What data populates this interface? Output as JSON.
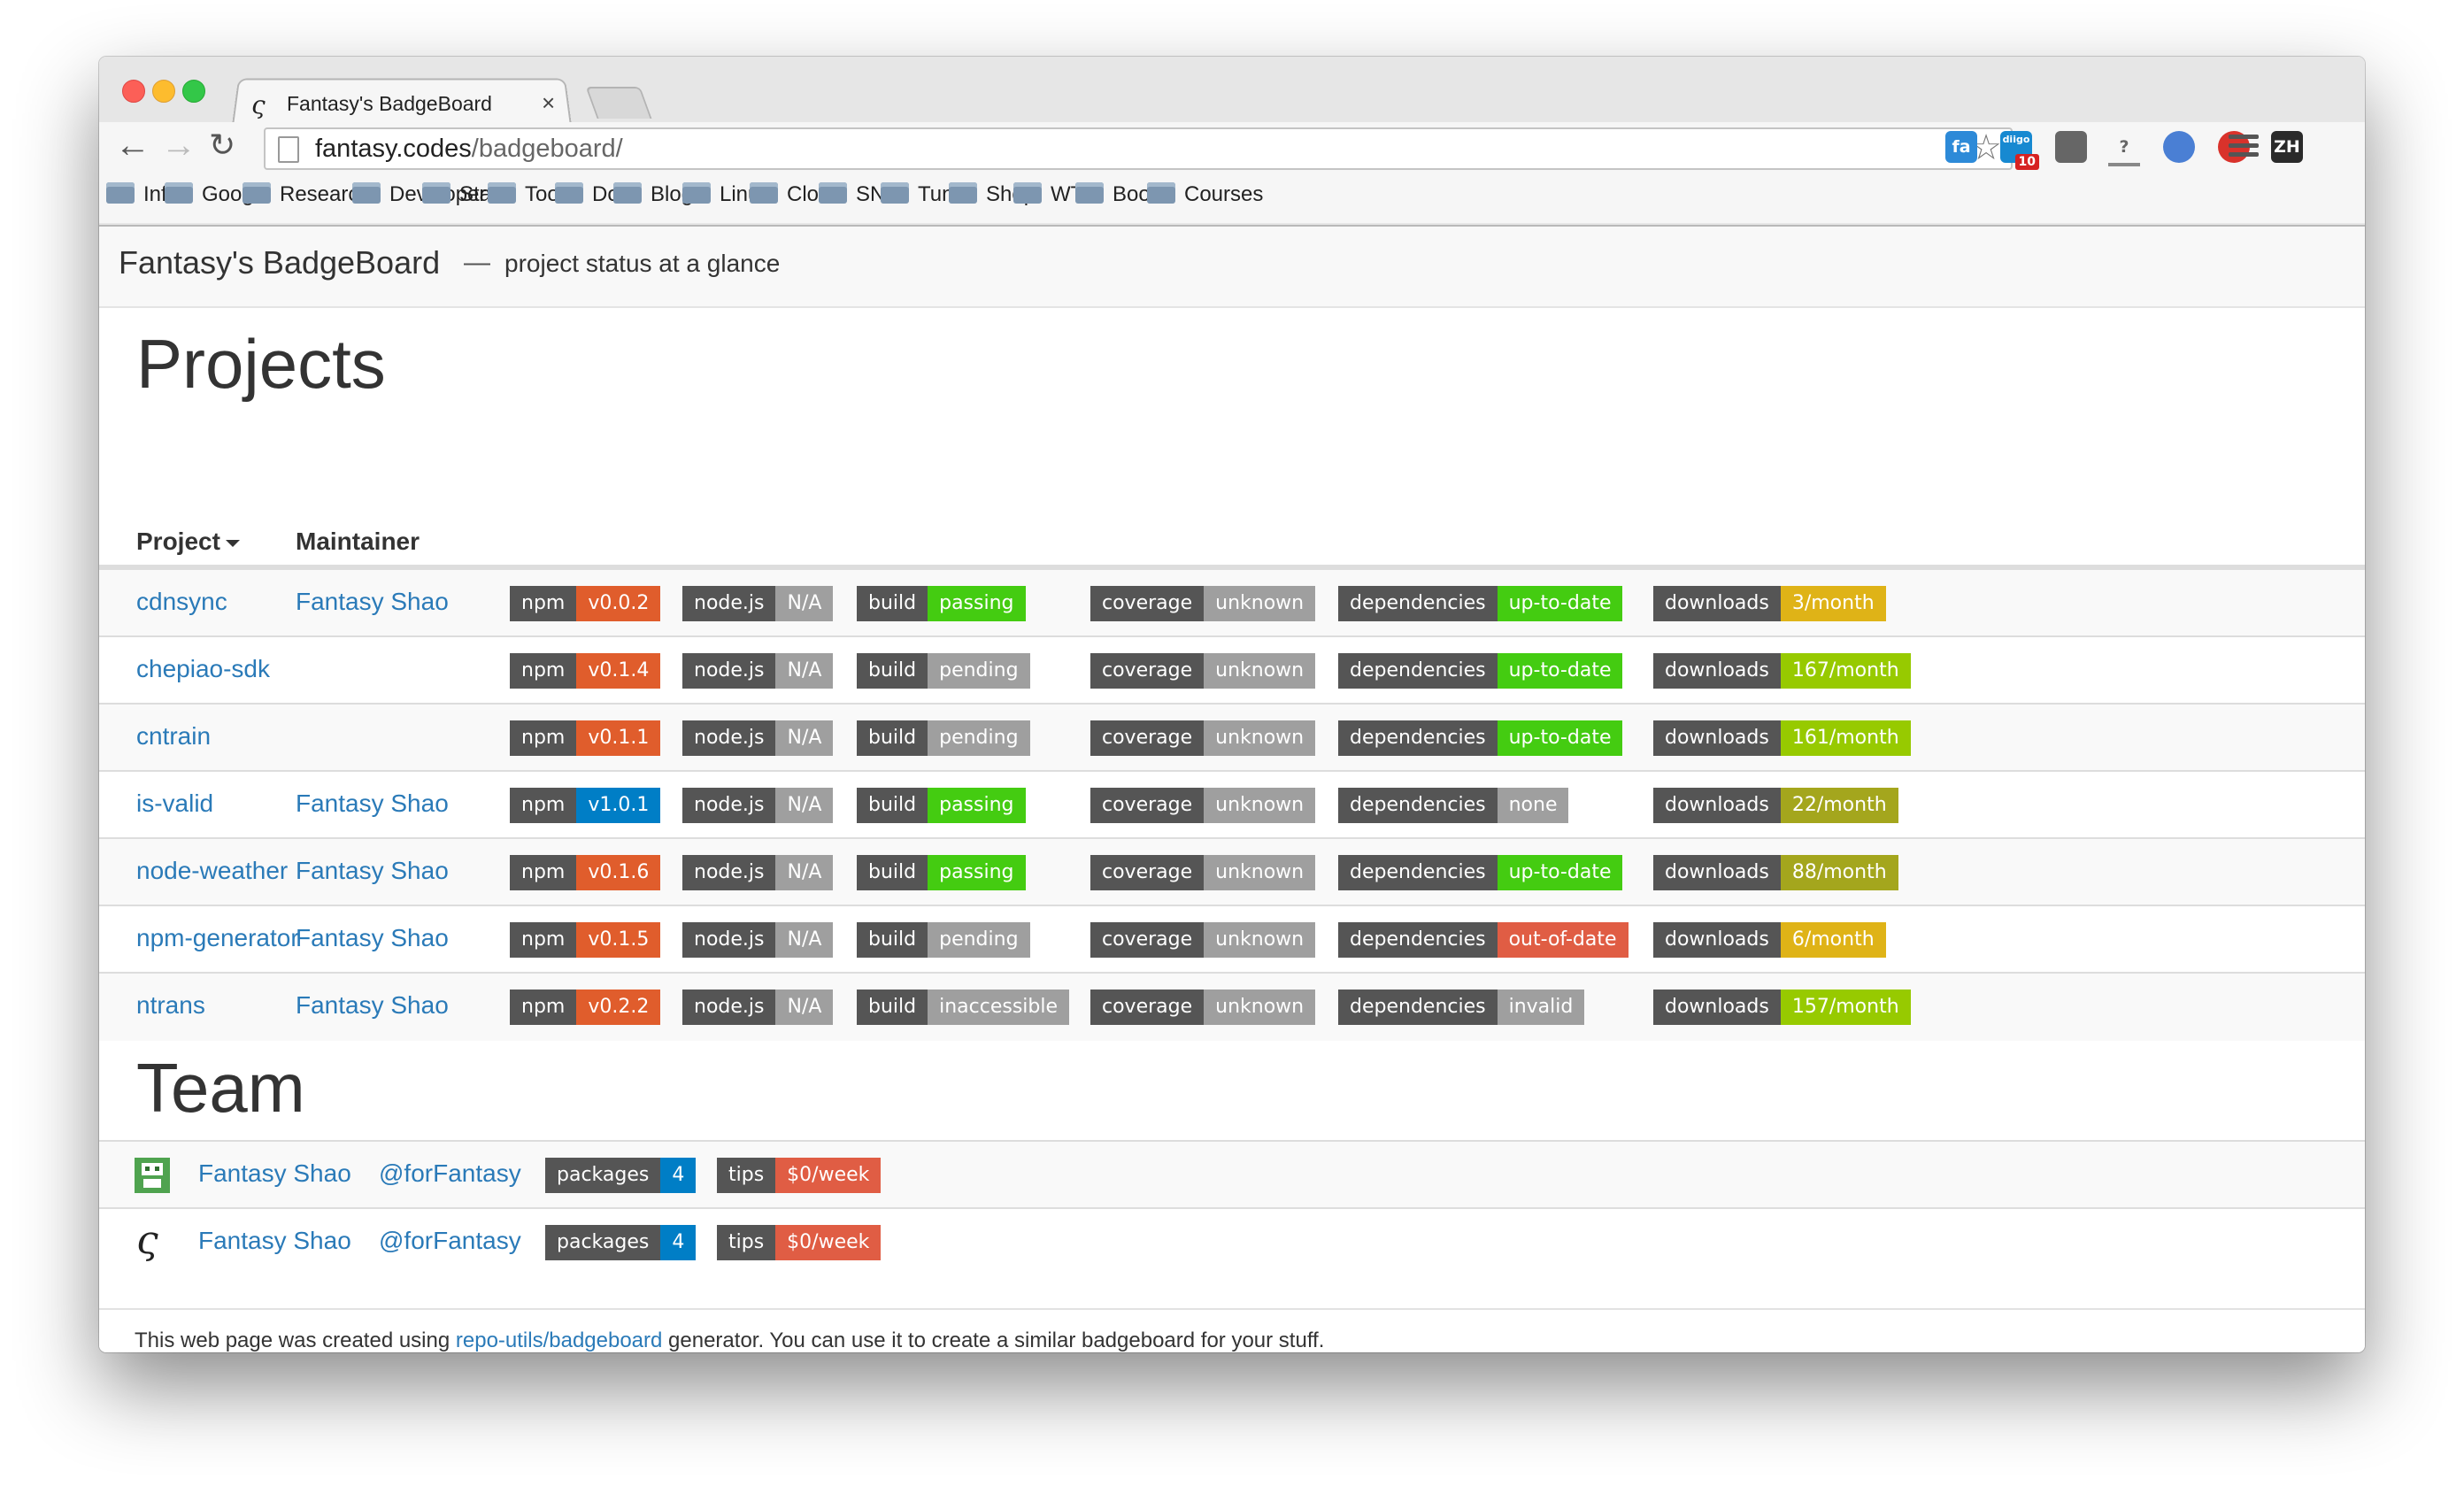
{
  "browser": {
    "tab_title": "Fantasy's BadgeBoard",
    "tab_favicon": "ς",
    "tab_close": "×",
    "url_host": "fantasy.codes",
    "url_path": "/badgeboard/",
    "bookmarks": [
      "Info",
      "Google",
      "Research",
      "Developer",
      "Stars",
      "Tools",
      "Doc",
      "Blogs",
      "Linux",
      "Cloud",
      "SNS",
      "Tuniu",
      "Shop",
      "WTF",
      "Books",
      "Courses"
    ],
    "extensions": [
      {
        "name": "fa-icon",
        "label": "fa",
        "color": "#2d8ad8"
      },
      {
        "name": "diigo-icon",
        "label": "diigo",
        "color": "#1789d1",
        "badge": "10"
      },
      {
        "name": "pocket-icon",
        "label": "",
        "color": "#666"
      },
      {
        "name": "help-tray-icon",
        "label": "?",
        "color": "#888"
      },
      {
        "name": "globe-icon",
        "label": "",
        "color": "#4a7fd4"
      },
      {
        "name": "adblock-hand-icon",
        "label": "",
        "color": "#d9322b"
      },
      {
        "name": "zh-icon",
        "label": "ZH",
        "color": "#2a2a2a"
      }
    ]
  },
  "page": {
    "brand": "Fantasy's BadgeBoard",
    "dash": "—",
    "tagline": "project status at a glance",
    "projects_heading": "Projects",
    "col_project": "Project",
    "col_maintainer": "Maintainer",
    "team_heading": "Team"
  },
  "colors": {
    "link": "#2a7ab8",
    "badge_label": "#555555",
    "orange": "#e05d2c",
    "blue": "#007ec6",
    "gray": "#9f9f9f",
    "green": "#4c1",
    "yellowgreen": "#a4a61d",
    "yellow": "#dfb317",
    "greenlight": "#97ca00",
    "red": "#e05d44"
  },
  "projects": [
    {
      "name": "cdnsync",
      "maintainer": "Fantasy Shao",
      "npm": "v0.0.2",
      "npm_color": "#e05d2c",
      "node": "N/A",
      "build": "passing",
      "build_color": "#44cc11",
      "coverage": "unknown",
      "deps": "up-to-date",
      "deps_color": "#44cc11",
      "downloads": "3/month",
      "dl_color": "#dfb317"
    },
    {
      "name": "chepiao-sdk",
      "maintainer": "",
      "npm": "v0.1.4",
      "npm_color": "#e05d2c",
      "node": "N/A",
      "build": "pending",
      "build_color": "#9f9f9f",
      "coverage": "unknown",
      "deps": "up-to-date",
      "deps_color": "#44cc11",
      "downloads": "167/month",
      "dl_color": "#97ca00"
    },
    {
      "name": "cntrain",
      "maintainer": "",
      "npm": "v0.1.1",
      "npm_color": "#e05d2c",
      "node": "N/A",
      "build": "pending",
      "build_color": "#9f9f9f",
      "coverage": "unknown",
      "deps": "up-to-date",
      "deps_color": "#44cc11",
      "downloads": "161/month",
      "dl_color": "#97ca00"
    },
    {
      "name": "is-valid",
      "maintainer": "Fantasy Shao",
      "npm": "v1.0.1",
      "npm_color": "#007ec6",
      "node": "N/A",
      "build": "passing",
      "build_color": "#44cc11",
      "coverage": "unknown",
      "deps": "none",
      "deps_color": "#9f9f9f",
      "downloads": "22/month",
      "dl_color": "#a4a61d"
    },
    {
      "name": "node-weather",
      "maintainer": "Fantasy Shao",
      "npm": "v0.1.6",
      "npm_color": "#e05d2c",
      "node": "N/A",
      "build": "passing",
      "build_color": "#44cc11",
      "coverage": "unknown",
      "deps": "up-to-date",
      "deps_color": "#44cc11",
      "downloads": "88/month",
      "dl_color": "#a4a61d"
    },
    {
      "name": "npm-generator",
      "maintainer": "Fantasy Shao",
      "npm": "v0.1.5",
      "npm_color": "#e05d2c",
      "node": "N/A",
      "build": "pending",
      "build_color": "#9f9f9f",
      "coverage": "unknown",
      "deps": "out-of-date",
      "deps_color": "#e05d44",
      "downloads": "6/month",
      "dl_color": "#dfb317"
    },
    {
      "name": "ntrans",
      "maintainer": "Fantasy Shao",
      "npm": "v0.2.2",
      "npm_color": "#e05d2c",
      "node": "N/A",
      "build": "inaccessible",
      "build_color": "#9f9f9f",
      "coverage": "unknown",
      "deps": "invalid",
      "deps_color": "#9f9f9f",
      "downloads": "157/month",
      "dl_color": "#97ca00"
    }
  ],
  "badge_labels": {
    "npm": "npm",
    "node": "node.js",
    "build": "build",
    "coverage": "coverage",
    "deps": "dependencies",
    "downloads": "downloads",
    "packages": "packages",
    "tips": "tips"
  },
  "team": [
    {
      "name": "Fantasy Shao",
      "handle": "@forFantasy",
      "packages": "4",
      "tips": "$0/week",
      "avatar": "pixel"
    },
    {
      "name": "Fantasy Shao",
      "handle": "@forFantasy",
      "packages": "4",
      "tips": "$0/week",
      "avatar": "glyph"
    }
  ],
  "footer": {
    "before": "This web page was created using ",
    "link": "repo-utils/badgeboard",
    "after": " generator. You can use it to create a similar badgeboard for your stuff."
  }
}
